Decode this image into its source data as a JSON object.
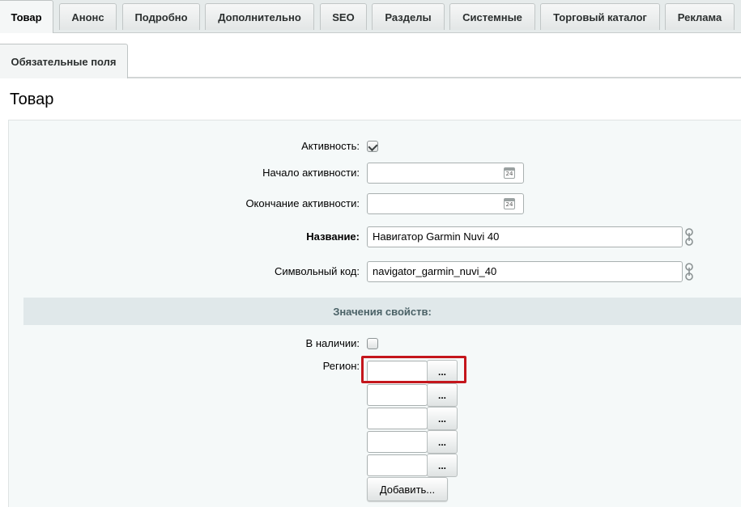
{
  "tabs": [
    {
      "label": "Товар",
      "active": true
    },
    {
      "label": "Анонс"
    },
    {
      "label": "Подробно"
    },
    {
      "label": "Дополнительно"
    },
    {
      "label": "SEO"
    },
    {
      "label": "Разделы"
    },
    {
      "label": "Системные"
    },
    {
      "label": "Торговый каталог"
    },
    {
      "label": "Реклама"
    }
  ],
  "subtabs": [
    {
      "label": "Обязательные поля"
    }
  ],
  "section_title": "Товар",
  "form": {
    "active": {
      "label": "Активность:",
      "checked": true
    },
    "active_from": {
      "label": "Начало активности:",
      "value": "",
      "calendar_day": "24"
    },
    "active_to": {
      "label": "Окончание активности:",
      "value": "",
      "calendar_day": "24"
    },
    "name": {
      "label": "Название:",
      "value": "Навигатор Garmin Nuvi 40"
    },
    "code": {
      "label": "Символьный код:",
      "value": "navigator_garmin_nuvi_40"
    }
  },
  "properties": {
    "header": "Значения свойств:",
    "in_stock": {
      "label": "В наличии:",
      "checked": false
    },
    "region": {
      "label": "Регион:",
      "inputs": [
        "",
        "",
        "",
        "",
        ""
      ],
      "browse_label": "...",
      "add_label": "Добавить..."
    }
  },
  "colors": {
    "tabbar_bg": "#e6ebeb",
    "panel_bg": "#f5f9f9",
    "props_header_bg": "#e0e8ea",
    "props_header_text": "#4b6267",
    "highlight": "#c4161c"
  }
}
